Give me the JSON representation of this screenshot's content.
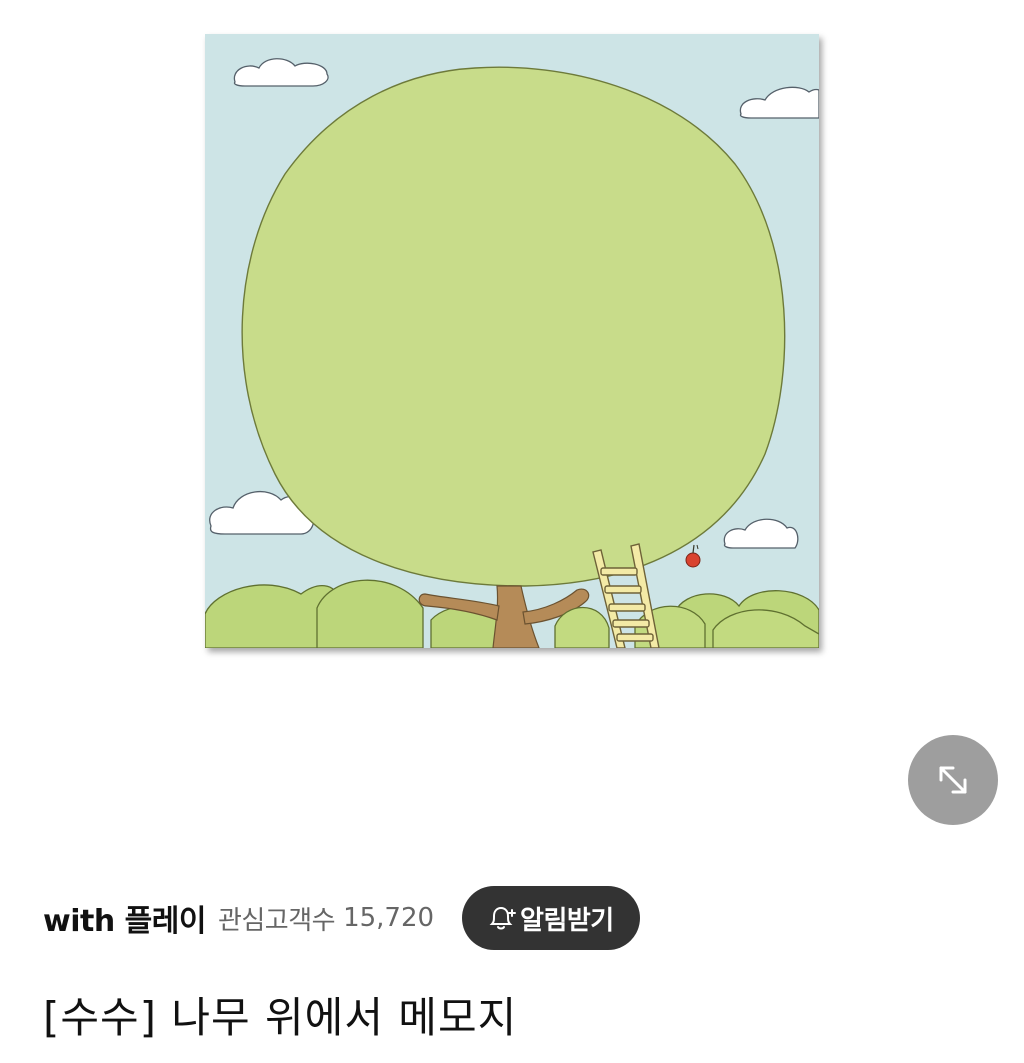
{
  "product": {
    "image_alt": "나무 위에서 메모지",
    "title": "[수수] 나무 위에서 메모지"
  },
  "seller": {
    "name": "with 플레이",
    "follower_label": "관심고객수",
    "follower_count": "15,720",
    "alert_button_label": "알림받기"
  },
  "icons": {
    "expand": "expand-arrows-icon",
    "alert": "bell-plus-icon"
  },
  "colors": {
    "sky": "#cde4e6",
    "foliage": "#c8dc8a",
    "trunk": "#b58b58",
    "button_dark": "#333333",
    "expand_circle": "#9e9e9e"
  }
}
